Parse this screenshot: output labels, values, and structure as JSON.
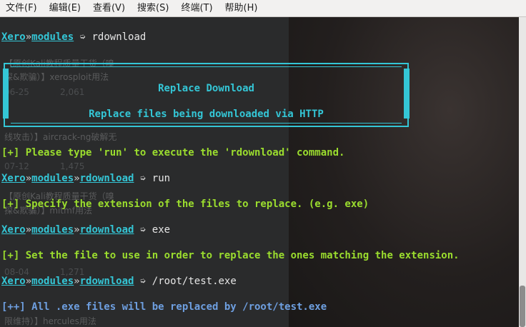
{
  "menubar": {
    "items": [
      "文件(F)",
      "编辑(E)",
      "查看(V)",
      "搜索(S)",
      "终端(T)",
      "帮助(H)"
    ]
  },
  "prompt": {
    "root": "Xero",
    "sep": "»",
    "module_dir": "modules",
    "arrow": "➭",
    "module": "rdownload"
  },
  "banner": {
    "title": "Replace Download",
    "subtitle": "Replace files being downloaded via HTTP"
  },
  "lines": {
    "first_cmd": "rdownload",
    "info1": "[+] Please type 'run' to execute the 'rdownload' command.",
    "cmd2": "run",
    "info2": "[+] Specify the extension of the files to replace. (e.g. exe)",
    "cmd3": "exe",
    "info3": "[+] Set the file to use in order to replace the ones matching the extension.",
    "cmd4": "/root/test.exe",
    "info4": "[++] All .exe files will be replaced by /root/test.exe"
  },
  "ghost_text": {
    "g1": "【原创Kali教程质量干货（嗅",
    "g2": "探&欺骗）】xerosploit用法",
    "g3": "06-25",
    "g4": "2,061",
    "g5": "线攻击）】aircrack-ng破解无",
    "g6": "07-12",
    "g7": "1,475",
    "g8": "【原创Kali教程质量干货（嗅",
    "g9": "探&欺骗）】mitmf用法",
    "g10": "08-04",
    "g11": "1,271",
    "g12": "限维持）】hercules用法"
  }
}
